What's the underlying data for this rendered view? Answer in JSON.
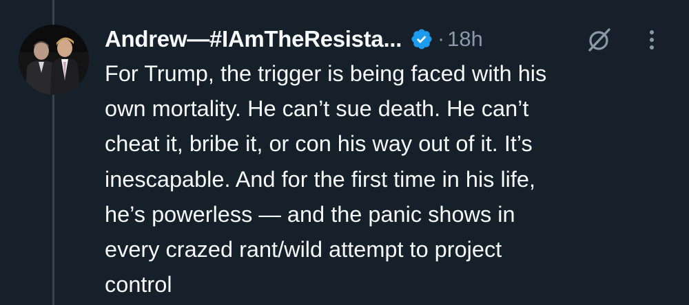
{
  "tweet": {
    "author_name": "Andrew—#IAmTheResista...",
    "verified": true,
    "separator": "·",
    "timestamp": "18h",
    "text": "For Trump, the trigger is being faced with his\nown mortality. He can’t sue death. He can’t\ncheat it, bribe it, or con his way out of it. It’s\ninescapable. And for the first time in his life,\nhe’s powerless — and the panic shows in\nevery crazed rant/wild attempt to project\ncontrol"
  },
  "icons": {
    "verified": "verified-badge-icon",
    "grok": "grok-icon",
    "more": "more-options-icon"
  },
  "colors": {
    "background": "#15202b",
    "primary_text": "#f7f9f9",
    "secondary_text": "#8b98a5",
    "verified_blue": "#1d9bf0",
    "thread_line": "#38444d"
  }
}
